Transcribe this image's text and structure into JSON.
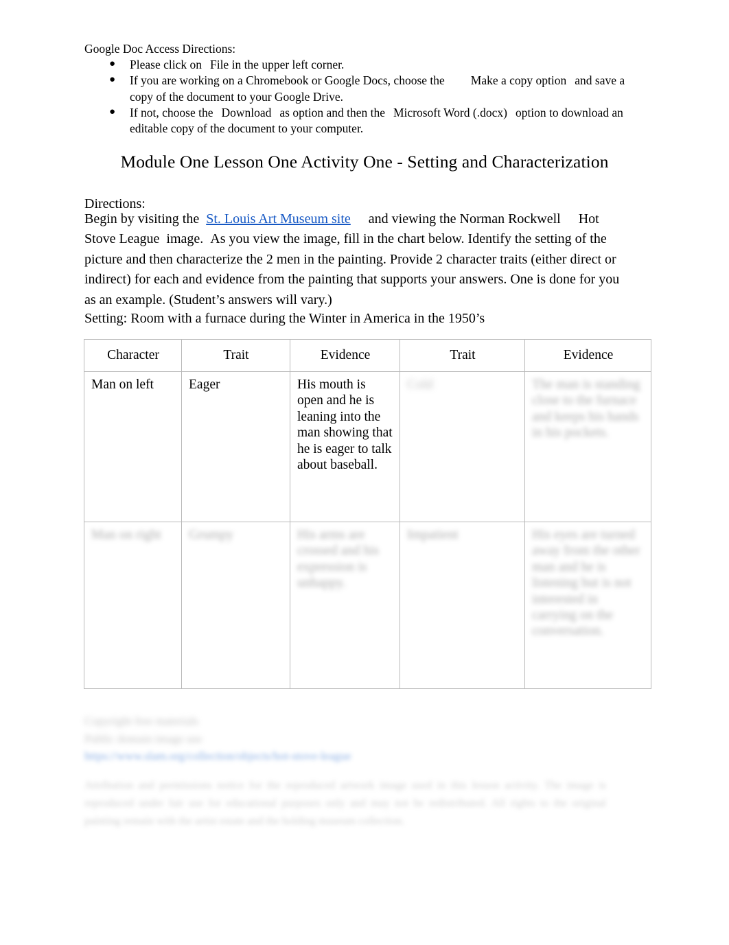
{
  "access_directions": {
    "heading": "Google Doc Access Directions:",
    "bullet_glyph": "●",
    "items": [
      {
        "part1": "Please click on",
        "emphasis1": "File",
        "part2": "in the upper left corner.",
        "emphasis2": "",
        "part3": ""
      },
      {
        "part1": "If you are working on a Chromebook or Google Docs, choose the",
        "emphasis1": "Make a copy option",
        "part2": "and save a copy of the document to your Google Drive.",
        "emphasis2": "",
        "part3": ""
      },
      {
        "part1": "If not, choose the",
        "emphasis1": "Download",
        "part2": "as option and then the",
        "emphasis2": "Microsoft Word (.docx)",
        "part3": "option to download an editable copy of the document to your computer."
      }
    ]
  },
  "title": "Module One Lesson One Activity One - Setting and Characterization",
  "directions": {
    "label": "Directions:",
    "sentence_start": "Begin by visiting the",
    "link_text": "St. Louis Art Museum site",
    "after_link": "and viewing the Norman Rockwell",
    "artwork_title": "Hot Stove League",
    "after_artwork": "image.",
    "rest": "As you view the image, fill in the chart below. Identify the setting of the picture and then characterize the 2 men in the painting. Provide 2 character traits (either direct or indirect) for each and evidence from the painting that supports your answers. One is done for you as an example. (Student’s answers will vary.)"
  },
  "setting": "Setting: Room with a furnace during the Winter in America in the 1950’s",
  "table": {
    "headers": [
      "Character",
      "Trait",
      "Evidence",
      "Trait",
      "Evidence"
    ],
    "rows": [
      {
        "character": "Man on left",
        "trait1": "Eager",
        "evidence1": "His mouth is open and he is leaning into the man showing that he is eager to talk about baseball.",
        "trait2": "Cold",
        "evidence2": "The man is standing close to the furnace and keeps his hands in his pockets."
      },
      {
        "character": "Man on right",
        "trait1": "Grumpy",
        "evidence1": "His arms are crossed and his expression is unhappy.",
        "evidence1_extra": "",
        "trait2": "Impatient",
        "evidence2": "His eyes are turned away from the other man and he is listening but is not interested in carrying on the conversation."
      }
    ]
  },
  "citation": {
    "line1": "Copyright free materials",
    "line2": "Public domain image use",
    "link": "https://www.slam.org/collection/objects/hot-stove-league"
  },
  "footer_note": "Attribution and permissions notice for the reproduced artwork image used in this lesson activity. The image is reproduced under fair use for educational purposes only and may not be redistributed. All rights to the original painting remain with the artist estate and the holding museum collection.",
  "colors": {
    "link": "#1457c4",
    "table_border": "#b9b9b9",
    "text": "#000000"
  }
}
